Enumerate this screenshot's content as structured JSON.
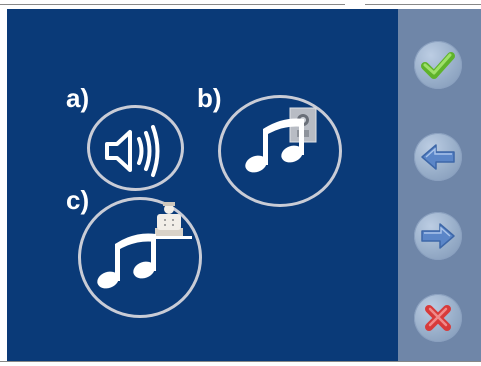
{
  "options": [
    {
      "id": "a",
      "label": "a)",
      "icon": "speaker-icon"
    },
    {
      "id": "b",
      "label": "b)",
      "icon": "music-note-outdoor-panel-icon"
    },
    {
      "id": "c",
      "label": "c)",
      "icon": "music-note-concierge-icon"
    }
  ],
  "sidebar": {
    "buttons": [
      {
        "name": "confirm-button",
        "icon": "checkmark-icon",
        "color": "#6fc23a"
      },
      {
        "name": "back-button",
        "icon": "arrow-left-icon",
        "color": "#5b86c8"
      },
      {
        "name": "forward-button",
        "icon": "arrow-right-icon",
        "color": "#5b86c8"
      },
      {
        "name": "cancel-button",
        "icon": "close-icon",
        "color": "#e04545"
      }
    ]
  },
  "colors": {
    "panel": "#0a3a78",
    "sidebar": "#6f86a8",
    "circle_stroke": "#c9ccd6",
    "icon": "#ffffff"
  }
}
